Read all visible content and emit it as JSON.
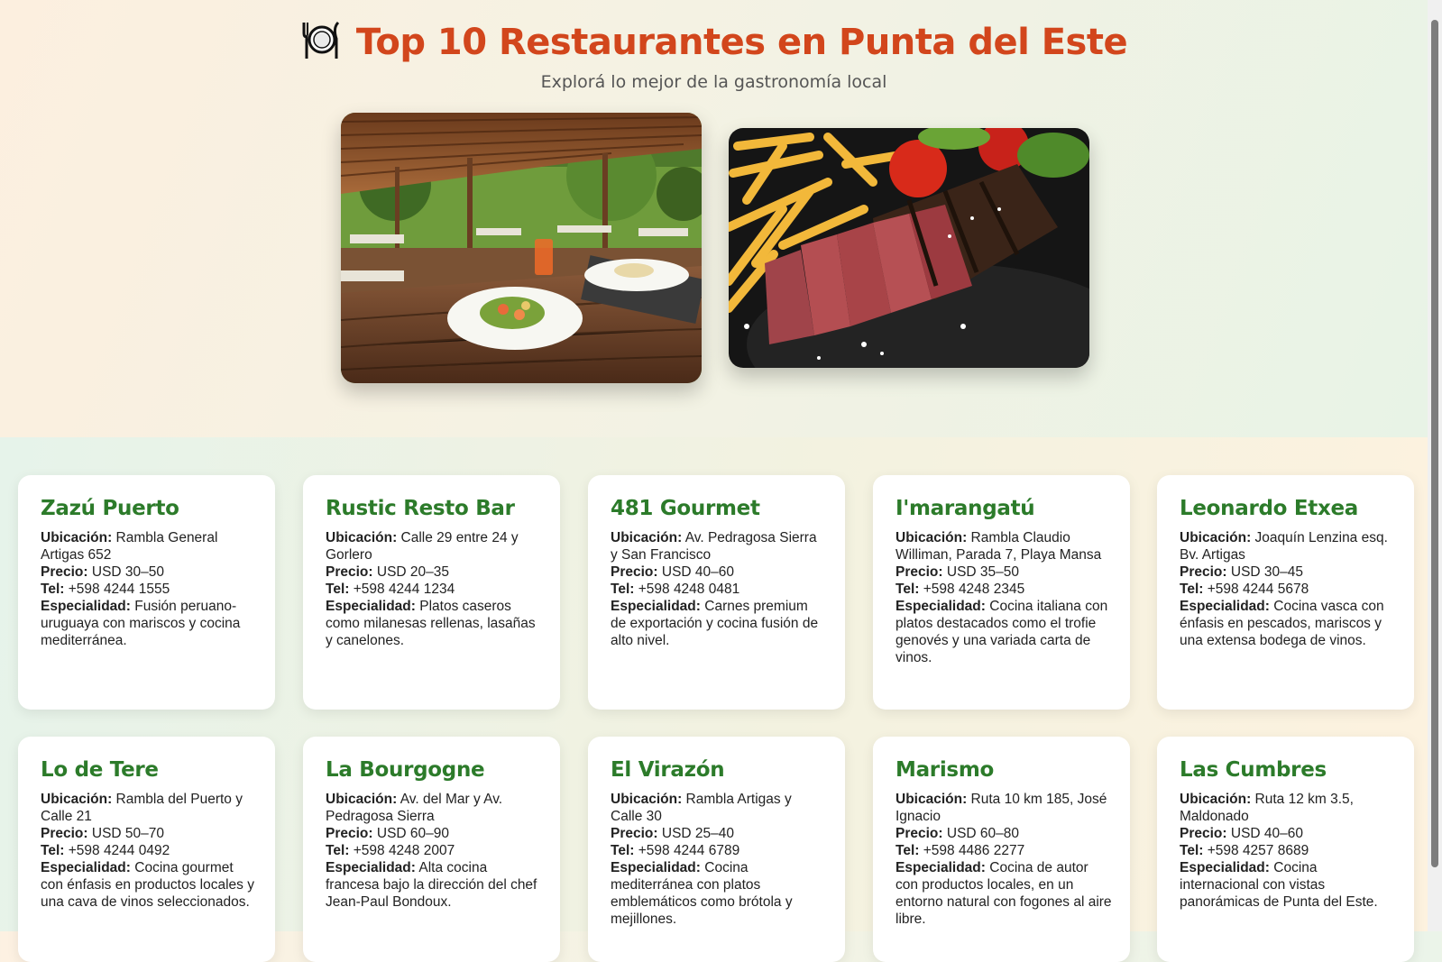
{
  "header": {
    "icon": "plate-cutlery-icon",
    "title": "Top 10 Restaurantes en Punta del Este",
    "subtitle": "Explorá lo mejor de la gastronomía local"
  },
  "photos": [
    {
      "icon": "restaurant-terrace-photo"
    },
    {
      "icon": "steak-fries-photo"
    }
  ],
  "labels": {
    "location": "Ubicación:",
    "price": "Precio:",
    "phone": "Tel:",
    "specialty": "Especialidad:"
  },
  "restaurants": [
    {
      "name": "Zazú Puerto",
      "location": "Rambla General Artigas 652",
      "price": "USD 30–50",
      "phone": "+598 4244 1555",
      "specialty": "Fusión peruano-uruguaya con mariscos y cocina mediterránea."
    },
    {
      "name": "Rustic Resto Bar",
      "location": "Calle 29 entre 24 y Gorlero",
      "price": "USD 20–35",
      "phone": "+598 4244 1234",
      "specialty": "Platos caseros como milanesas rellenas, lasañas y canelones."
    },
    {
      "name": "481 Gourmet",
      "location": "Av. Pedragosa Sierra y San Francisco",
      "price": "USD 40–60",
      "phone": "+598 4248 0481",
      "specialty": "Carnes premium de exportación y cocina fusión de alto nivel."
    },
    {
      "name": "I'marangatú",
      "location": "Rambla Claudio Williman, Parada 7, Playa Mansa",
      "price": "USD 35–50",
      "phone": "+598 4248 2345",
      "specialty": "Cocina italiana con platos destacados como el trofie genovés y una variada carta de vinos."
    },
    {
      "name": "Leonardo Etxea",
      "location": "Joaquín Lenzina esq. Bv. Artigas",
      "price": "USD 30–45",
      "phone": "+598 4244 5678",
      "specialty": "Cocina vasca con énfasis en pescados, mariscos y una extensa bodega de vinos."
    },
    {
      "name": "Lo de Tere",
      "location": "Rambla del Puerto y Calle 21",
      "price": "USD 50–70",
      "phone": "+598 4244 0492",
      "specialty": "Cocina gourmet con énfasis en productos locales y una cava de vinos seleccionados."
    },
    {
      "name": "La Bourgogne",
      "location": "Av. del Mar y Av. Pedragosa Sierra",
      "price": "USD 60–90",
      "phone": "+598 4248 2007",
      "specialty": "Alta cocina francesa bajo la dirección del chef Jean-Paul Bondoux."
    },
    {
      "name": "El Virazón",
      "location": "Rambla Artigas y Calle 30",
      "price": "USD 25–40",
      "phone": "+598 4244 6789",
      "specialty": "Cocina mediterránea con platos emblemáticos como brótola y mejillones."
    },
    {
      "name": "Marismo",
      "location": "Ruta 10 km 185, José Ignacio",
      "price": "USD 60–80",
      "phone": "+598 4486 2277",
      "specialty": "Cocina de autor con productos locales, en un entorno natural con fogones al aire libre."
    },
    {
      "name": "Las Cumbres",
      "location": "Ruta 12 km 3.5, Maldonado",
      "price": "USD 40–60",
      "phone": "+598 4257 8689",
      "specialty": "Cocina internacional con vistas panorámicas de Punta del Este."
    }
  ]
}
